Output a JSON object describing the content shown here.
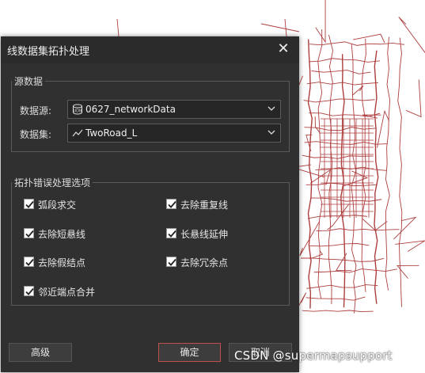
{
  "dialog": {
    "title": "线数据集拓扑处理",
    "source_group": {
      "label": "源数据",
      "datasource_label": "数据源:",
      "datasource_value": "0627_networkData",
      "dataset_label": "数据集:",
      "dataset_value": "TwoRoad_L"
    },
    "options_group": {
      "label": "拓扑错误处理选项",
      "options": [
        {
          "label": "弧段求交",
          "checked": true
        },
        {
          "label": "去除重复线",
          "checked": true
        },
        {
          "label": "去除短悬线",
          "checked": true
        },
        {
          "label": "长悬线延伸",
          "checked": true
        },
        {
          "label": "去除假结点",
          "checked": true
        },
        {
          "label": "去除冗余点",
          "checked": true
        },
        {
          "label": "邻近端点合并",
          "checked": true
        }
      ]
    },
    "buttons": {
      "advanced": "高级",
      "ok": "确定",
      "cancel": "取消"
    }
  },
  "watermark": "CSDN @supermapsupport",
  "colors": {
    "dialog_bg": "#303030",
    "road_line": "#a52a2a",
    "ok_border": "#c0504d"
  }
}
